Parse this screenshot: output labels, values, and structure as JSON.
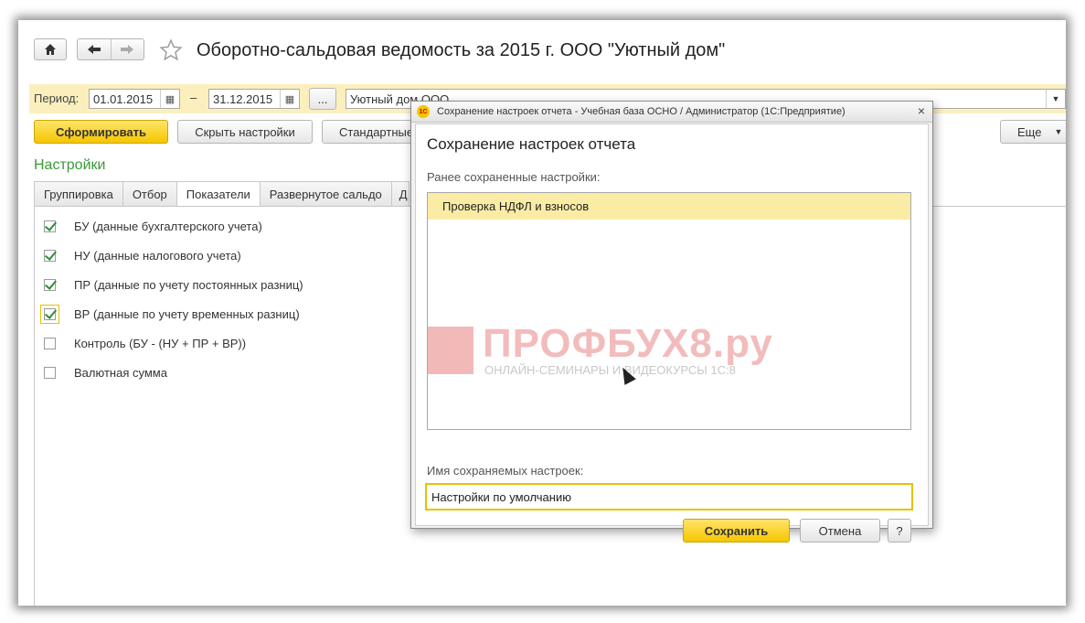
{
  "header": {
    "title": "Оборотно-сальдовая ведомость за 2015 г. ООО \"Уютный дом\""
  },
  "period": {
    "label": "Период:",
    "from": "01.01.2015",
    "dash": "–",
    "to": "31.12.2015",
    "more": "...",
    "org": "Уютный дом ООО"
  },
  "toolbar": {
    "generate": "Сформировать",
    "hide_settings": "Скрыть настройки",
    "standard": "Стандартные",
    "more": "Еще"
  },
  "settings": {
    "title": "Настройки",
    "tabs": [
      "Группировка",
      "Отбор",
      "Показатели",
      "Развернутое сальдо",
      "Д"
    ],
    "active_tab": "Показатели",
    "checkboxes": [
      {
        "label": "БУ (данные бухгалтерского учета)",
        "checked": true
      },
      {
        "label": "НУ (данные налогового учета)",
        "checked": true
      },
      {
        "label": "ПР (данные по учету постоянных разниц)",
        "checked": true
      },
      {
        "label": "ВР (данные по учету временных разниц)",
        "checked": true
      },
      {
        "label": "Контроль (БУ - (НУ + ПР + ВР))",
        "checked": false
      },
      {
        "label": "Валютная сумма",
        "checked": false
      }
    ]
  },
  "dialog": {
    "window_title": "Сохранение настроек отчета - Учебная база ОСНО / Администратор  (1С:Предприятие)",
    "close": "×",
    "heading": "Сохранение настроек отчета",
    "saved_label": "Ранее сохраненные настройки:",
    "saved_items": [
      "Проверка НДФЛ и взносов"
    ],
    "name_label": "Имя сохраняемых настроек:",
    "name_value": "Настройки по умолчанию",
    "save": "Сохранить",
    "cancel": "Отмена",
    "help": "?"
  },
  "watermark": {
    "text": "ПРОФБУХ8.ру",
    "subtext": "ОНЛАЙН-СЕМИНАРЫ И ВИДЕОКУРСЫ 1С:8"
  },
  "colors": {
    "accent_yellow": "#f5c600",
    "period_bar": "#fbf0bd",
    "section_green": "#3a9a3a",
    "list_highlight": "#fbeca5"
  }
}
